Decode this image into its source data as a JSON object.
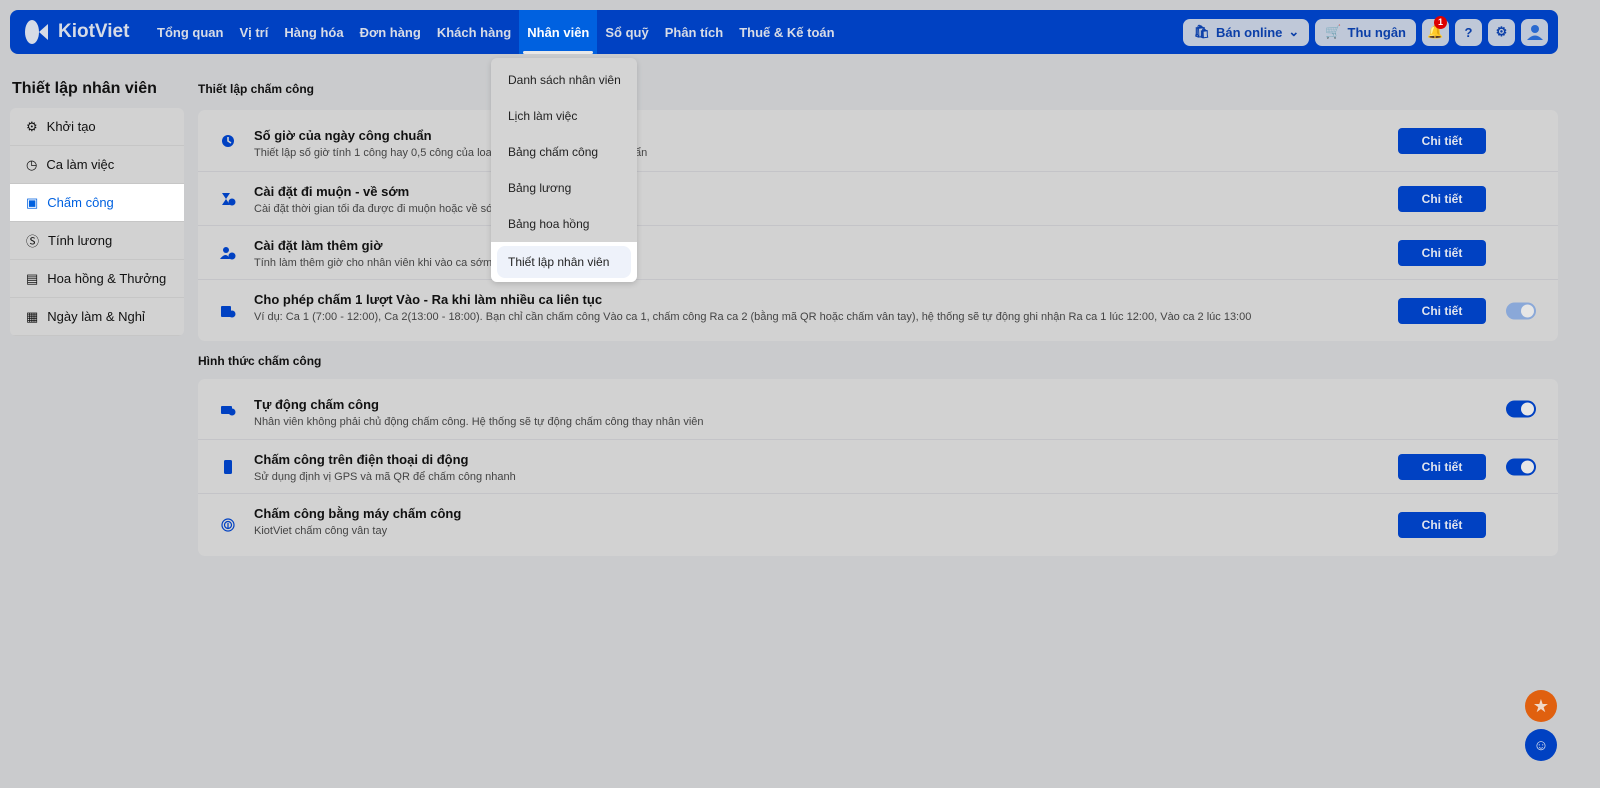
{
  "nav": {
    "logo": "KiotViet",
    "tabs": [
      "Tổng quan",
      "Vị trí",
      "Hàng hóa",
      "Đơn hàng",
      "Khách hàng",
      "Nhân viên",
      "Sổ quỹ",
      "Phân tích",
      "Thuế & Kế toán"
    ],
    "active_tab": "Nhân viên",
    "online": "Bán online",
    "cashier": "Thu ngân",
    "notif_count": "1"
  },
  "dropdown": [
    "Danh sách nhân viên",
    "Lịch làm việc",
    "Bảng chấm công",
    "Bảng lương",
    "Bảng hoa hồng",
    "Thiết lập nhân viên"
  ],
  "sidebar": {
    "title": "Thiết lập nhân viên",
    "items": [
      "Khởi tạo",
      "Ca làm việc",
      "Chấm công",
      "Tính lương",
      "Hoa hồng & Thưởng",
      "Ngày làm & Nghỉ"
    ],
    "active": "Chấm công"
  },
  "section1": {
    "title": "Thiết lập chấm công",
    "rows": [
      {
        "title": "Số giờ của ngày công chuẩn",
        "desc": "Thiết lập số giờ tính 1 công hay 0,5 công của loa",
        "desc_tail": "ẩn",
        "button": "Chi tiết"
      },
      {
        "title": "Cài đặt đi muộn - về sớm",
        "desc": "Cài đặt thời gian tối đa được đi muộn hoặc về sớ",
        "button": "Chi tiết"
      },
      {
        "title": "Cài đặt làm thêm giờ",
        "desc": "Tính làm thêm giờ cho nhân viên khi vào ca sớm",
        "button": "Chi tiết"
      },
      {
        "title": "Cho phép chấm 1 lượt Vào - Ra khi làm nhiều ca liên tục",
        "desc": "Ví dụ: Ca 1 (7:00 - 12:00), Ca 2(13:00 - 18:00). Bạn chỉ cần chấm công Vào ca 1, chấm công Ra ca 2 (bằng mã QR hoặc chấm vân tay), hệ thống sẽ tự động ghi nhận Ra ca 1 lúc 12:00, Vào ca 2 lúc 13:00",
        "button": "Chi tiết",
        "toggle": "on-disabled"
      }
    ]
  },
  "section2": {
    "title": "Hình thức chấm công",
    "rows": [
      {
        "title": "Tự động chấm công",
        "desc": "Nhân viên không phải chủ động chấm công. Hệ thống sẽ tự động chấm công thay nhân viên",
        "toggle": "on"
      },
      {
        "title": "Chấm công trên điện thoại di động",
        "desc": "Sử dụng định vị GPS và mã QR để chấm công nhanh",
        "button": "Chi tiết",
        "toggle": "on"
      },
      {
        "title": "Chấm công bằng máy chấm công",
        "desc": "KiotViet chấm công vân tay",
        "button": "Chi tiết"
      }
    ]
  },
  "colors": {
    "brand": "#0041c2",
    "active": "#0061e0",
    "fab_star": "#e0600f"
  }
}
